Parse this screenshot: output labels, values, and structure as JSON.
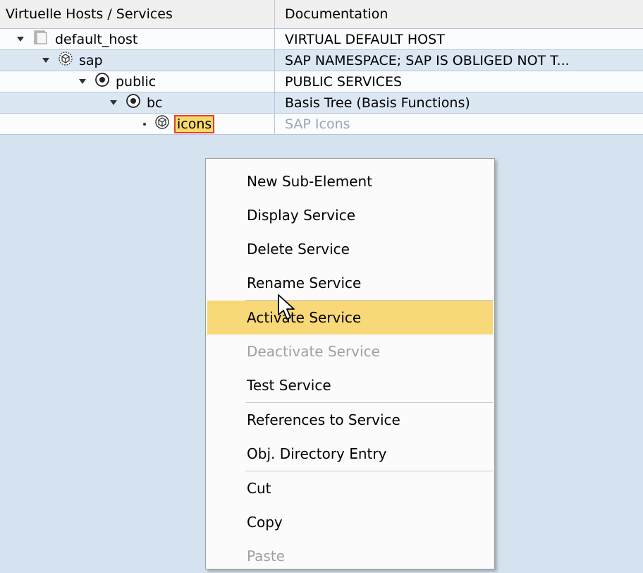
{
  "columns": {
    "hosts": "Virtuelle Hosts / Services",
    "doc": "Documentation"
  },
  "rows": [
    {
      "name": "default_host",
      "doc": "VIRTUAL DEFAULT HOST"
    },
    {
      "name": "sap",
      "doc": "SAP NAMESPACE; SAP IS OBLIGED NOT T..."
    },
    {
      "name": "public",
      "doc": "PUBLIC SERVICES"
    },
    {
      "name": "bc",
      "doc": "Basis Tree (Basis Functions)"
    },
    {
      "name": "icons",
      "doc": "SAP Icons"
    }
  ],
  "menu": {
    "new_sub": {
      "label": "New Sub-Element"
    },
    "display": {
      "label": "Display Service"
    },
    "delete": {
      "label": "Delete Service"
    },
    "rename": {
      "label": "Rename Service"
    },
    "activate": {
      "label": "Activate Service"
    },
    "deactivate": {
      "label": "Deactivate Service"
    },
    "test": {
      "label": "Test Service"
    },
    "references": {
      "label": "References to Service"
    },
    "obj_dir": {
      "label": "Obj. Directory Entry"
    },
    "cut": {
      "label": "Cut"
    },
    "copy": {
      "label": "Copy"
    },
    "paste": {
      "label": "Paste"
    }
  },
  "icons": {
    "host": "host-folder-icon",
    "namespace": "namespace-icon",
    "service_node": "service-node-icon",
    "service": "service-icon",
    "cursor": "mouse-pointer-icon"
  }
}
